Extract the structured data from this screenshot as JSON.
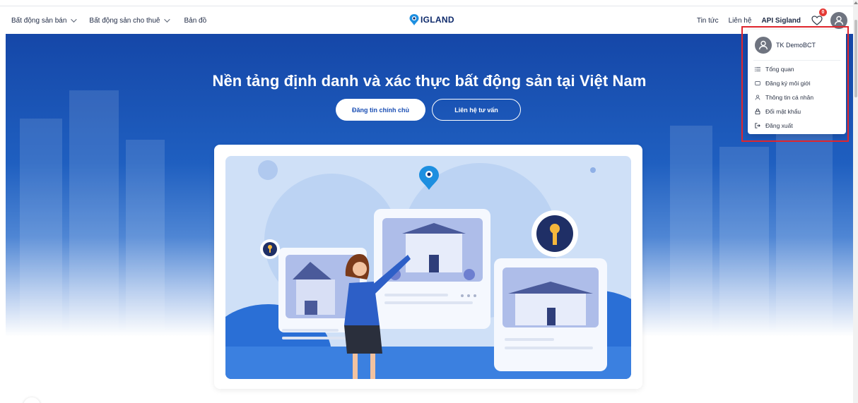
{
  "nav": {
    "left_items": [
      {
        "label": "Bất động sản bán"
      },
      {
        "label": "Bất động sản cho thuê"
      },
      {
        "label": "Bản đồ"
      }
    ],
    "logo_text": "IGLAND",
    "right_items": [
      {
        "label": "Tin tức"
      },
      {
        "label": "Liên hệ"
      },
      {
        "label": "API Sigland"
      }
    ],
    "favorites_count": "0"
  },
  "hero": {
    "title": "Nền tảng định danh và xác thực bất động sản tại Việt Nam",
    "primary_button": "Đăng tin chính chủ",
    "secondary_button": "Liên hệ tư vấn"
  },
  "user_menu": {
    "username": "TK DemoBCT",
    "items": [
      {
        "label": "Tổng quan",
        "icon": "list-icon"
      },
      {
        "label": "Đăng ký môi giới",
        "icon": "card-icon"
      },
      {
        "label": "Thông tin cá nhân",
        "icon": "user-icon"
      },
      {
        "label": "Đổi mật khẩu",
        "icon": "lock-icon"
      },
      {
        "label": "Đăng xuất",
        "icon": "logout-icon"
      }
    ]
  },
  "colors": {
    "brand_blue": "#1547a8",
    "highlight_red": "#e0262d",
    "badge_red": "#e53935"
  }
}
